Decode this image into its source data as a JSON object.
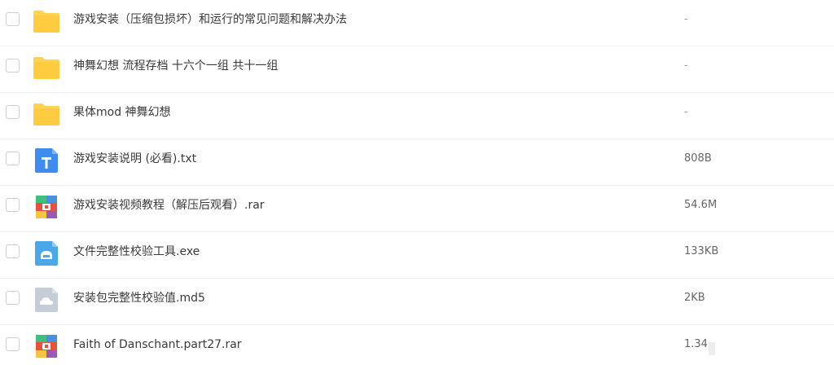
{
  "files": [
    {
      "name": "游戏安装（压缩包损坏）和运行的常见问题和解决办法",
      "size": "-",
      "icon": "folder-icon"
    },
    {
      "name": "神舞幻想 流程存档 十六个一组 共十一组",
      "size": "-",
      "icon": "folder-icon"
    },
    {
      "name": "果体mod 神舞幻想",
      "size": "-",
      "icon": "folder-icon"
    },
    {
      "name": "游戏安装说明 (必看).txt",
      "size": "808B",
      "icon": "txt-file-icon"
    },
    {
      "name": "游戏安装视频教程（解压后观看）.rar",
      "size": "54.6M",
      "icon": "rar-archive-icon"
    },
    {
      "name": "文件完整性校验工具.exe",
      "size": "133KB",
      "icon": "exe-file-icon"
    },
    {
      "name": "安装包完整性校验值.md5",
      "size": "2KB",
      "icon": "unknown-file-icon"
    },
    {
      "name": "Faith of Danschant.part27.rar",
      "size": "1.34",
      "icon": "rar-archive-icon"
    }
  ],
  "colors": {
    "folder": "#ffd254",
    "txt": "#3f8cf0",
    "exe": "#4aa8ea",
    "unknown": "#c5cdd6",
    "rar_red": "#e84f3d",
    "rar_yellow": "#f6c343",
    "rar_green": "#3fbf7f"
  }
}
